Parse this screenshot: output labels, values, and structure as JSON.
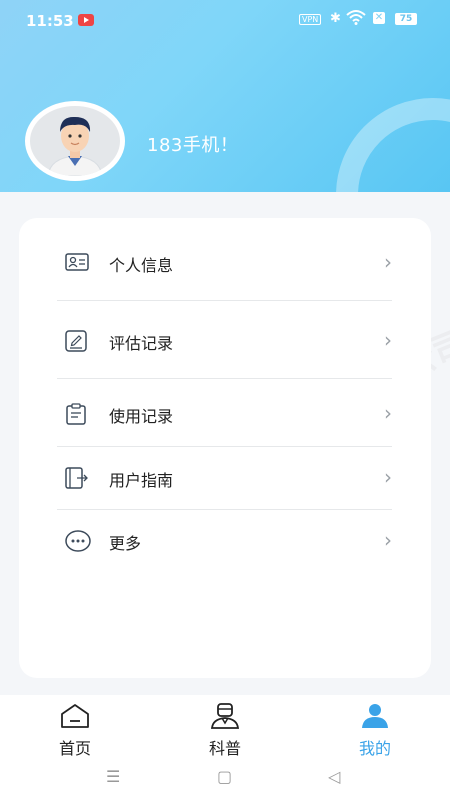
{
  "status_bar": {
    "time": "11:53",
    "vpn": "VPN",
    "battery": "75"
  },
  "profile": {
    "username": "183手机！"
  },
  "menu": {
    "items": [
      {
        "label": "个人信息",
        "icon": "id-card-icon"
      },
      {
        "label": "评估记录",
        "icon": "edit-note-icon"
      },
      {
        "label": "使用记录",
        "icon": "clipboard-icon"
      },
      {
        "label": "用户指南",
        "icon": "guide-icon"
      },
      {
        "label": "更多",
        "icon": "more-icon"
      }
    ]
  },
  "watermark": "上海励司达医疗科技有限公司",
  "tabs": [
    {
      "label": "首页",
      "icon": "home-icon"
    },
    {
      "label": "科普",
      "icon": "doctor-icon"
    },
    {
      "label": "我的",
      "icon": "user-icon",
      "active": true
    }
  ],
  "colors": {
    "accent": "#3aa3e8",
    "header": "#7fd6f9"
  }
}
